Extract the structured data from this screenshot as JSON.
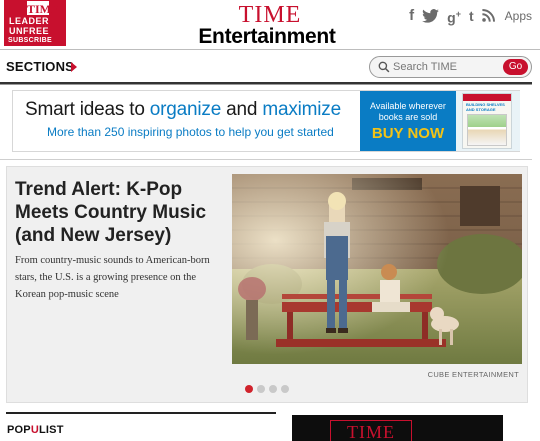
{
  "badge": {
    "logo": "TIME",
    "line1": "LEADER",
    "line2": "UNFREE",
    "subscribe": "SUBSCRIBE"
  },
  "masthead": {
    "title": "TIME",
    "subtitle": "Entertainment"
  },
  "social": {
    "apps_label": "Apps",
    "icons": [
      "facebook-icon",
      "twitter-icon",
      "googleplus-icon",
      "tumblr-icon",
      "rss-icon"
    ]
  },
  "nav": {
    "sections_label": "SECTIONS"
  },
  "search": {
    "placeholder": "Search TIME",
    "button_label": "Go"
  },
  "ad": {
    "headline_pre": "Smart ideas to ",
    "headline_w1": "organize",
    "headline_mid": " and ",
    "headline_w2": "maximize",
    "subline": "More than 250 inspiring photos to help you get started",
    "avail_line1": "Available wherever",
    "avail_line2": "books are sold",
    "buy_label": "BUY NOW",
    "book_title": "BUILDING SHELVES AND STORAGE"
  },
  "feature": {
    "title": "Trend Alert: K-Pop Meets Country Music (and New Jersey)",
    "description": "From country-music sounds to American-born stars, the U.S. is a growing presence on the Korean pop-music scene",
    "photo_credit": "CUBE ENTERTAINMENT",
    "slide_count": 4,
    "active_slide": 1
  },
  "bottom": {
    "populist_pre": "POP",
    "populist_hl": "U",
    "populist_post": "LIST",
    "promo_logo": "TIME"
  },
  "colors": {
    "brand_red": "#c8102e",
    "ad_blue": "#0a7cc4",
    "buy_yellow": "#f3c316"
  }
}
